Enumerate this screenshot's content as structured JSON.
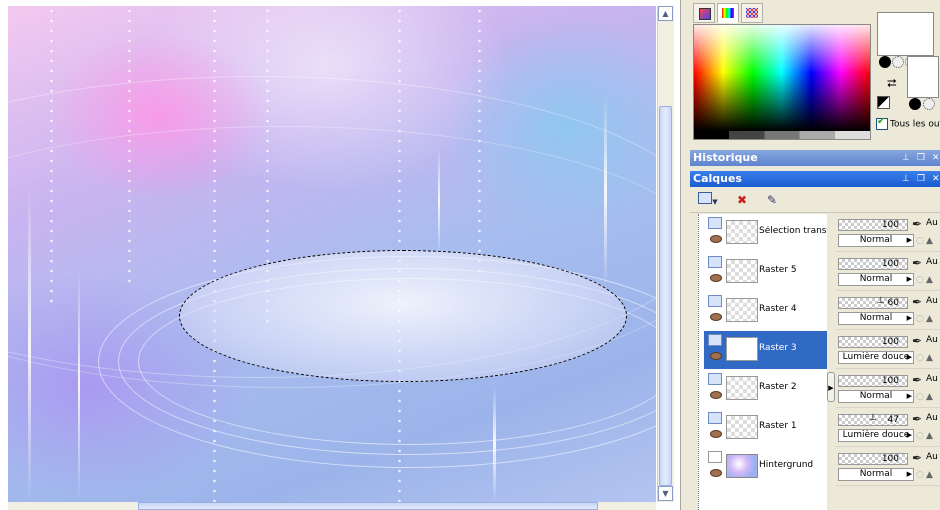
{
  "materials": {
    "tous_label": "Tous les out"
  },
  "panels": {
    "historique": "Historique",
    "calques": "Calques"
  },
  "layers": [
    {
      "name": "Sélection transfo",
      "opacity": "100",
      "blend": "Normal",
      "selected": false,
      "bg": false
    },
    {
      "name": "Raster 5",
      "opacity": "100",
      "blend": "Normal",
      "selected": false,
      "bg": false
    },
    {
      "name": "Raster 4",
      "opacity": "60",
      "blend": "Normal",
      "selected": false,
      "bg": false
    },
    {
      "name": "Raster 3",
      "opacity": "100",
      "blend": "Lumière douce",
      "selected": true,
      "bg": false
    },
    {
      "name": "Raster 2",
      "opacity": "100",
      "blend": "Normal",
      "selected": false,
      "bg": false
    },
    {
      "name": "Raster 1",
      "opacity": "47",
      "blend": "Lumière douce",
      "selected": false,
      "bg": false
    },
    {
      "name": "Hintergrund",
      "opacity": "100",
      "blend": "Normal",
      "selected": false,
      "bg": true
    }
  ],
  "au_label": "Au"
}
